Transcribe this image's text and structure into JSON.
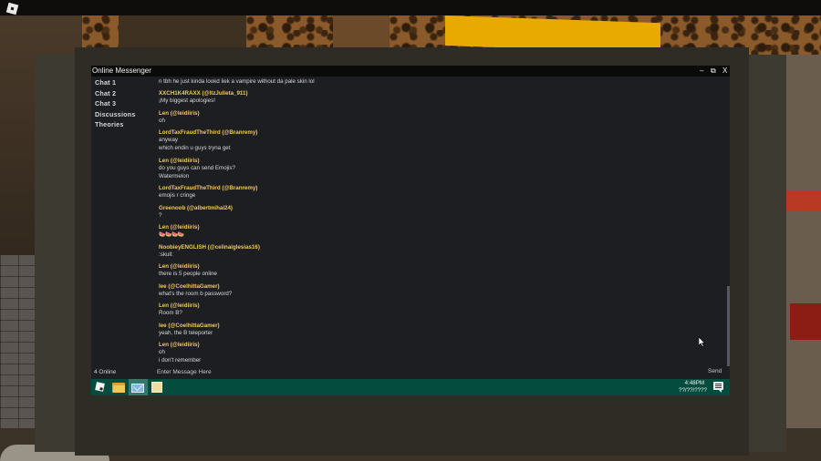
{
  "window": {
    "title": "Online Messenger",
    "minimize_glyph": "–",
    "restore_glyph": "⧉",
    "close_glyph": "X"
  },
  "sidebar": {
    "items": [
      {
        "label": "Chat 1"
      },
      {
        "label": "Chat 2"
      },
      {
        "label": "Chat 3"
      },
      {
        "label": "Discussions"
      },
      {
        "label": "Theories"
      }
    ]
  },
  "chat": {
    "partial_line": "n tbh he just kinda lookd liek a vampire without da pale skin lol",
    "messages": [
      {
        "user": "XXCH1K4RAXX (@ItzJulieta_911)",
        "lines": [
          "¡My biggest apologies!"
        ]
      },
      {
        "user": "Len (@leidiiris)",
        "lines": [
          "oh"
        ]
      },
      {
        "user": "LordTaxFraudTheThird (@Branremy)",
        "lines": [
          "anyway",
          "which endin u guys tryna get"
        ]
      },
      {
        "user": "Len (@leidiiris)",
        "lines": [
          "do you guys can send Emojis?",
          "Watermelon"
        ]
      },
      {
        "user": "LordTaxFraudTheThird (@Branremy)",
        "lines": [
          "emojis r cringe"
        ]
      },
      {
        "user": "Greenoob (@albertmihai24)",
        "lines": [
          "?"
        ]
      },
      {
        "user": "Len (@leidiiris)",
        "emoji": "🍉🍉🍉🍉"
      },
      {
        "user": "NoobieyENGLISH (@celinaiglesias16)",
        "lines": [
          ":skull:"
        ]
      },
      {
        "user": "Len (@leidiiris)",
        "lines": [
          "there is 5 people online"
        ]
      },
      {
        "user": "lee (@CoelhittaGamer)",
        "lines": [
          "what's the room b password?"
        ]
      },
      {
        "user": "Len (@leidiiris)",
        "lines": [
          "Room B?"
        ]
      },
      {
        "user": "lee (@CoelhittaGamer)",
        "lines": [
          "yeah, the B teleporter"
        ]
      },
      {
        "user": "Len (@leidiiris)",
        "lines": [
          "oh",
          "i don't remember"
        ]
      }
    ]
  },
  "bottom_bar": {
    "online_count": "4 Online",
    "input_placeholder": "Enter Message Here",
    "input_value": "",
    "send_label": "Send"
  },
  "taskbar": {
    "time": "4:48PM",
    "date": "??/??/????",
    "icons": [
      "start-icon",
      "folder-icon",
      "mail-icon",
      "notes-icon",
      "notification-icon"
    ]
  },
  "colors": {
    "window_bg": "#1c1e22",
    "titlebar_bg": "#0a0a0a",
    "username": "#f0c95a",
    "message_text": "#d8d8d8",
    "taskbar_bg": "#044d3e",
    "taskbar_active": "#3a7569"
  }
}
